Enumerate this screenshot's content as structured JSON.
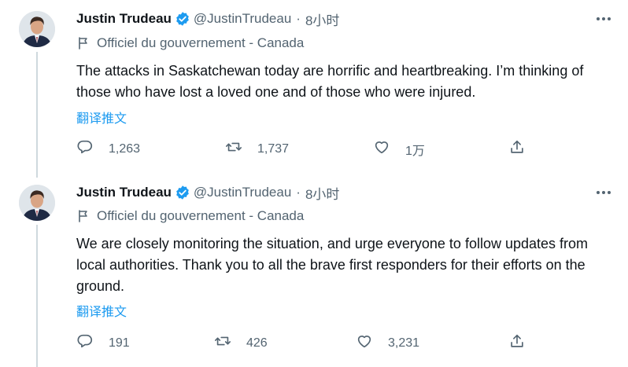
{
  "tweets": [
    {
      "author": {
        "name": "Justin Trudeau",
        "handle": "@JustinTrudeau"
      },
      "time": "8小时",
      "label": "Officiel du gouvernement - Canada",
      "text": "The attacks in Saskatchewan today are horrific and heartbreaking. I’m thinking of those who have lost a loved one and of those who were injured.",
      "translate": "翻译推文",
      "stats": {
        "replies": "1,263",
        "retweets": "1,737",
        "likes": "1万"
      }
    },
    {
      "author": {
        "name": "Justin Trudeau",
        "handle": "@JustinTrudeau"
      },
      "time": "8小时",
      "label": "Officiel du gouvernement - Canada",
      "text": "We are closely monitoring the situation, and urge everyone to follow updates from local authorities. Thank you to all the brave first responders for their efforts on the ground.",
      "translate": "翻译推文",
      "stats": {
        "replies": "191",
        "retweets": "426",
        "likes": "3,231"
      }
    }
  ],
  "separator": "·",
  "colors": {
    "accent": "#1d9bf0",
    "secondary_text": "#536471",
    "thread_line": "#cfd9de"
  },
  "icons": [
    "verified-badge-icon",
    "flag-icon",
    "more-icon",
    "reply-icon",
    "retweet-icon",
    "like-icon",
    "share-icon"
  ]
}
